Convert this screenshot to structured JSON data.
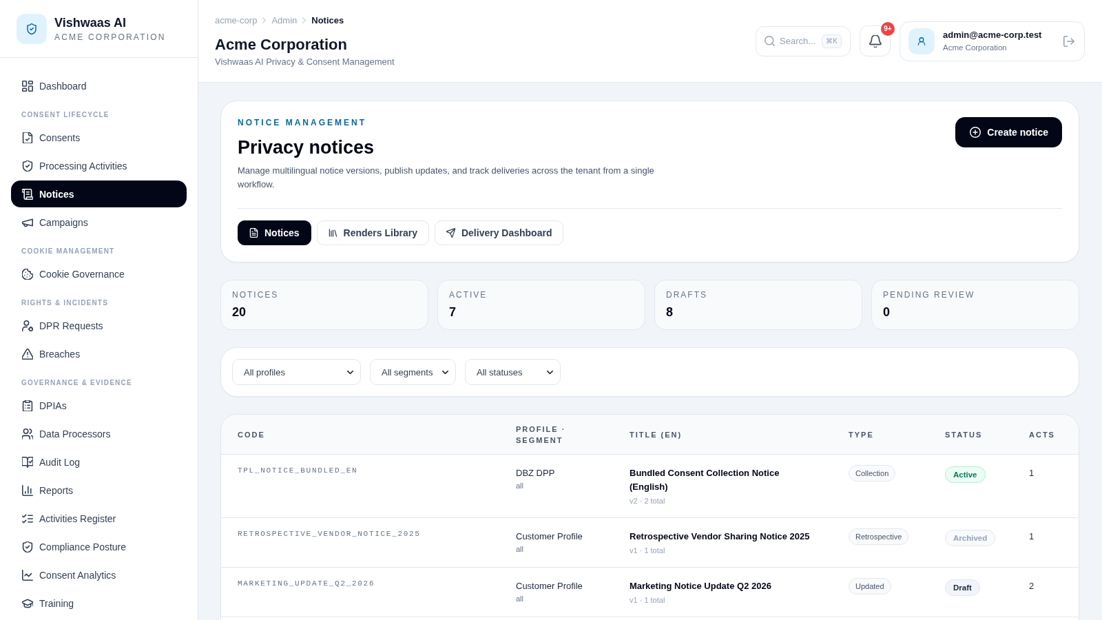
{
  "sidebar": {
    "brand": {
      "name": "Vishwaas AI",
      "org": "ACME CORPORATION"
    },
    "sections": [
      {
        "items": [
          {
            "label": "Dashboard",
            "selected": false
          }
        ]
      },
      {
        "title": "CONSENT LIFECYCLE",
        "items": [
          {
            "label": "Consents",
            "selected": false
          },
          {
            "label": "Processing Activities",
            "selected": false
          },
          {
            "label": "Notices",
            "selected": true
          },
          {
            "label": "Campaigns",
            "selected": false
          }
        ]
      },
      {
        "title": "COOKIE MANAGEMENT",
        "items": [
          {
            "label": "Cookie Governance",
            "selected": false
          }
        ]
      },
      {
        "title": "RIGHTS & INCIDENTS",
        "items": [
          {
            "label": "DPR Requests",
            "selected": false
          },
          {
            "label": "Breaches",
            "selected": false
          }
        ]
      },
      {
        "title": "GOVERNANCE & EVIDENCE",
        "items": [
          {
            "label": "DPIAs",
            "selected": false
          },
          {
            "label": "Data Processors",
            "selected": false
          },
          {
            "label": "Audit Log",
            "selected": false
          },
          {
            "label": "Reports",
            "selected": false
          },
          {
            "label": "Activities Register",
            "selected": false
          },
          {
            "label": "Compliance Posture",
            "selected": false
          },
          {
            "label": "Consent Analytics",
            "selected": false
          },
          {
            "label": "Training",
            "selected": false
          }
        ]
      }
    ]
  },
  "header": {
    "breadcrumb": [
      {
        "label": "acme-corp",
        "current": false
      },
      {
        "label": "Admin",
        "current": false
      },
      {
        "label": "Notices",
        "current": true
      }
    ],
    "title": "Acme Corporation",
    "subtitle": "Vishwaas AI Privacy & Consent Management",
    "search": {
      "placeholder": "Search...",
      "shortcut": "⌘K"
    },
    "notifications": {
      "badge": "9+"
    },
    "user": {
      "email": "admin@acme-corp.test",
      "org": "Acme Corporation"
    }
  },
  "intro": {
    "eyebrow": "NOTICE MANAGEMENT",
    "title": "Privacy notices",
    "description": "Manage multilingual notice versions, publish updates, and track deliveries across the tenant from a single workflow.",
    "create_button": "Create notice",
    "tabs": [
      {
        "label": "Notices",
        "selected": true
      },
      {
        "label": "Renders Library",
        "selected": false
      },
      {
        "label": "Delivery Dashboard",
        "selected": false
      }
    ]
  },
  "stats": [
    {
      "label": "NOTICES",
      "value": "20"
    },
    {
      "label": "ACTIVE",
      "value": "7"
    },
    {
      "label": "DRAFTS",
      "value": "8"
    },
    {
      "label": "PENDING REVIEW",
      "value": "0"
    }
  ],
  "filters": [
    {
      "value": "All profiles"
    },
    {
      "value": "All segments"
    },
    {
      "value": "All statuses"
    }
  ],
  "table": {
    "columns": [
      "CODE",
      "PROFILE · SEGMENT",
      "TITLE (EN)",
      "TYPE",
      "STATUS",
      "ACTS"
    ],
    "rows": [
      {
        "code": "TPL_NOTICE_BUNDLED_EN",
        "profile": "DBZ DPP",
        "segment": "all",
        "title": "Bundled Consent Collection Notice (English)",
        "meta": "v2 · 2 total",
        "type": "Collection",
        "status": {
          "label": "Active",
          "kind": "active"
        },
        "acts": "1"
      },
      {
        "code": "RETROSPECTIVE_VENDOR_NOTICE_2025",
        "profile": "Customer Profile",
        "segment": "all",
        "title": "Retrospective Vendor Sharing Notice 2025",
        "meta": "v1 · 1 total",
        "type": "Retrospective",
        "status": {
          "label": "Archived",
          "kind": "archived"
        },
        "acts": "1"
      },
      {
        "code": "MARKETING_UPDATE_Q2_2026",
        "profile": "Customer Profile",
        "segment": "all",
        "title": "Marketing Notice Update Q2 2026",
        "meta": "v1 · 1 total",
        "type": "Updated",
        "status": {
          "label": "Draft",
          "kind": "draft"
        },
        "acts": "2"
      }
    ]
  }
}
